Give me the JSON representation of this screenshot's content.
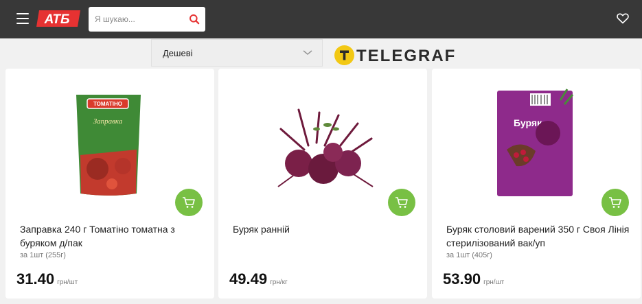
{
  "header": {
    "logo_text": "АТБ",
    "search_placeholder": "Я шукаю...",
    "brand_color": "#e63232"
  },
  "sort": {
    "selected": "Дешеві"
  },
  "watermark": {
    "text": "TELEGRAF"
  },
  "products": [
    {
      "title": "Заправка 240 г Томатіно томатна з буряком д/пак",
      "unit_note": "за 1шт (255г)",
      "price": "31.40",
      "price_unit": "грн/шт",
      "package_brand": "ТОМАТІНО",
      "package_label": "Заправка"
    },
    {
      "title": "Буряк ранній",
      "unit_note": "",
      "price": "49.49",
      "price_unit": "грн/кг"
    },
    {
      "title": "Буряк столовий варений 350 г Своя Лінія стерилізований вак/уп",
      "unit_note": "за 1шт (405г)",
      "price": "53.90",
      "price_unit": "грн/шт",
      "package_label": "Буряк"
    }
  ],
  "colors": {
    "topbar": "#383838",
    "cart_button": "#78c044",
    "accent_yellow": "#f2c814"
  }
}
